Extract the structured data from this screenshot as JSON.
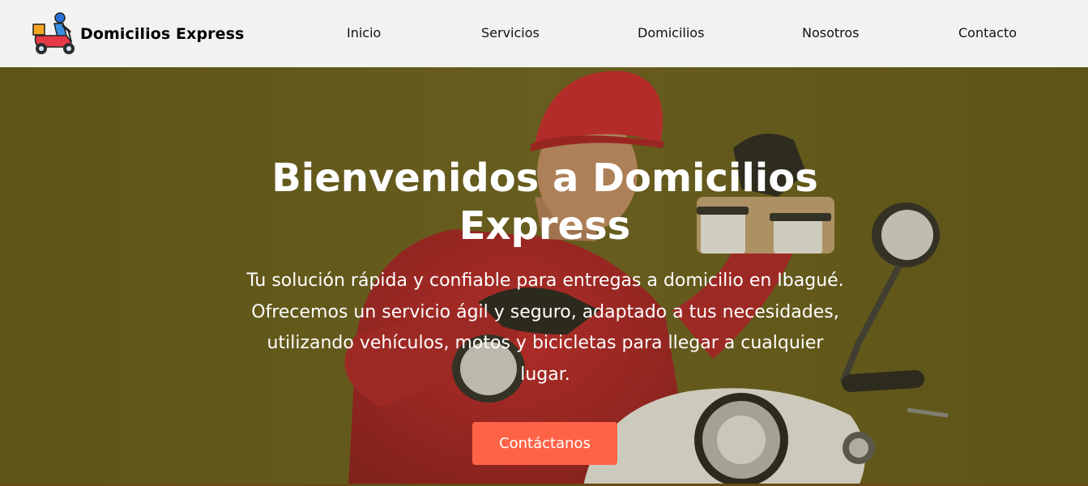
{
  "header": {
    "brand": "Domicilios Express",
    "logo_icon": "delivery-scooter-icon",
    "nav": [
      {
        "label": "Inicio"
      },
      {
        "label": "Servicios"
      },
      {
        "label": "Domicilios"
      },
      {
        "label": "Nosotros"
      },
      {
        "label": "Contacto"
      }
    ]
  },
  "hero": {
    "title": "Bienvenidos a Domicilios Express",
    "text": "Tu solución rápida y confiable para entregas a domicilio en Ibagué. Ofrecemos un servicio ágil y seguro, adaptado a tus necesidades, utilizando vehículos, motos y bicicletas para llegar a cualquier lugar.",
    "cta_label": "Contáctanos",
    "background_image": "delivery-man-on-scooter-photo"
  },
  "colors": {
    "navbar_bg": "#f2f2f2",
    "hero_bg": "#655a20",
    "cta_bg": "#ff6347",
    "hero_text": "#ffffff"
  }
}
